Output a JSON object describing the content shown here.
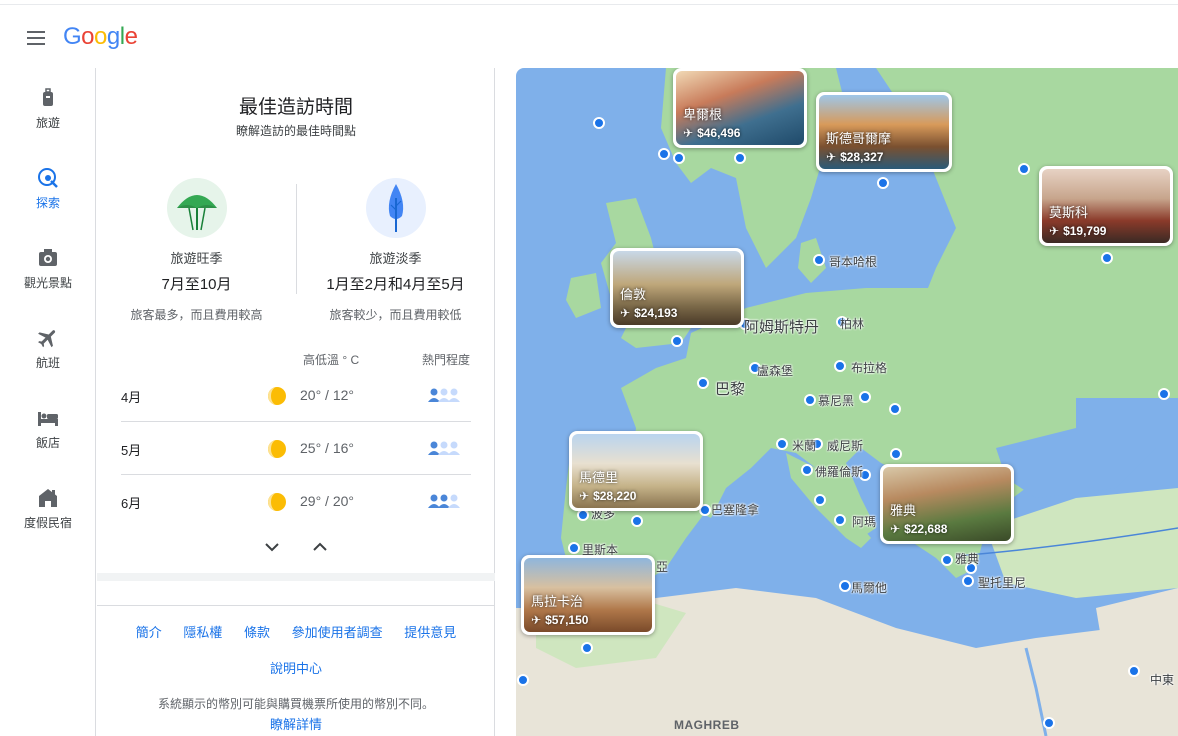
{
  "header": {
    "logo_text": "Google",
    "logo_colors": [
      "#4285F4",
      "#EA4335",
      "#FBBC05",
      "#4285F4",
      "#34A853",
      "#EA4335"
    ]
  },
  "rail": {
    "items": [
      {
        "label": "旅遊",
        "icon": "luggage-icon"
      },
      {
        "label": "探索",
        "icon": "explore-icon",
        "active": true
      },
      {
        "label": "觀光景點",
        "icon": "camera-icon"
      },
      {
        "label": "航班",
        "icon": "flight-icon"
      },
      {
        "label": "飯店",
        "icon": "hotel-icon"
      },
      {
        "label": "度假民宿",
        "icon": "house-icon"
      }
    ]
  },
  "panel": {
    "title": "最佳造訪時間",
    "subtitle": "瞭解造訪的最佳時間點",
    "peak": {
      "name": "旅遊旺季",
      "range": "7月至10月",
      "note": "旅客最多，而且費用較高",
      "icon": "umbrella-icon"
    },
    "off": {
      "name": "旅遊淡季",
      "range": "1月至2月和4月至5月",
      "note": "旅客較少，而且費用較低",
      "icon": "tree-icon"
    },
    "col_temp": "高低溫 ° C",
    "col_pop": "熱門程度",
    "months": [
      {
        "name": "4月",
        "temp": "20° / 12°",
        "weather": "partly-sunny-icon",
        "popularity": 1
      },
      {
        "name": "5月",
        "temp": "25° / 16°",
        "weather": "partly-sunny-icon",
        "popularity": 1
      },
      {
        "name": "6月",
        "temp": "29° / 20°",
        "weather": "partly-sunny-icon",
        "popularity": 2
      }
    ],
    "footer_links": [
      "簡介",
      "隱私權",
      "條款",
      "參加使用者調查",
      "提供意見"
    ],
    "help": "說明中心",
    "currency_note": "系統顯示的幣別可能與購買機票所使用的幣別不同。",
    "learn_more": "瞭解詳情"
  },
  "map": {
    "cards": [
      {
        "name": "卑爾根",
        "price": "$46,496",
        "theme": "harbor"
      },
      {
        "name": "斯德哥爾摩",
        "price": "$28,327",
        "theme": "old-town"
      },
      {
        "name": "莫斯科",
        "price": "$19,799",
        "theme": "kremlin"
      },
      {
        "name": "倫敦",
        "price": "$24,193",
        "theme": "parliament"
      },
      {
        "name": "馬德里",
        "price": "$28,220",
        "theme": "palace"
      },
      {
        "name": "雅典",
        "price": "$22,688",
        "theme": "hillside"
      },
      {
        "name": "馬拉卡治",
        "price": "$57,150",
        "theme": "desert-city"
      }
    ],
    "labels": {
      "copenhagen": "哥本哈根",
      "amsterdam": "阿姆斯特丹",
      "berlin": "柏林",
      "luxembourg": "盧森堡",
      "prague": "布拉格",
      "paris": "巴黎",
      "munich": "慕尼黑",
      "milan": "米蘭",
      "venice": "威尼斯",
      "florence": "佛羅倫斯",
      "barcelona": "巴塞隆拿",
      "porto": "波多",
      "lisbon": "里斯本",
      "seville": "亞",
      "naples": "阿瑪",
      "athens": "雅典",
      "malta": "馬爾他",
      "santorini": "聖托里尼",
      "middle_east": "中東",
      "maghreb": "MAGHREB"
    },
    "colors": {
      "sea": "#7fb0ea",
      "land": "#a8d8a0",
      "land_south": "#e8e4d8",
      "pin": "#1a73e8"
    }
  }
}
